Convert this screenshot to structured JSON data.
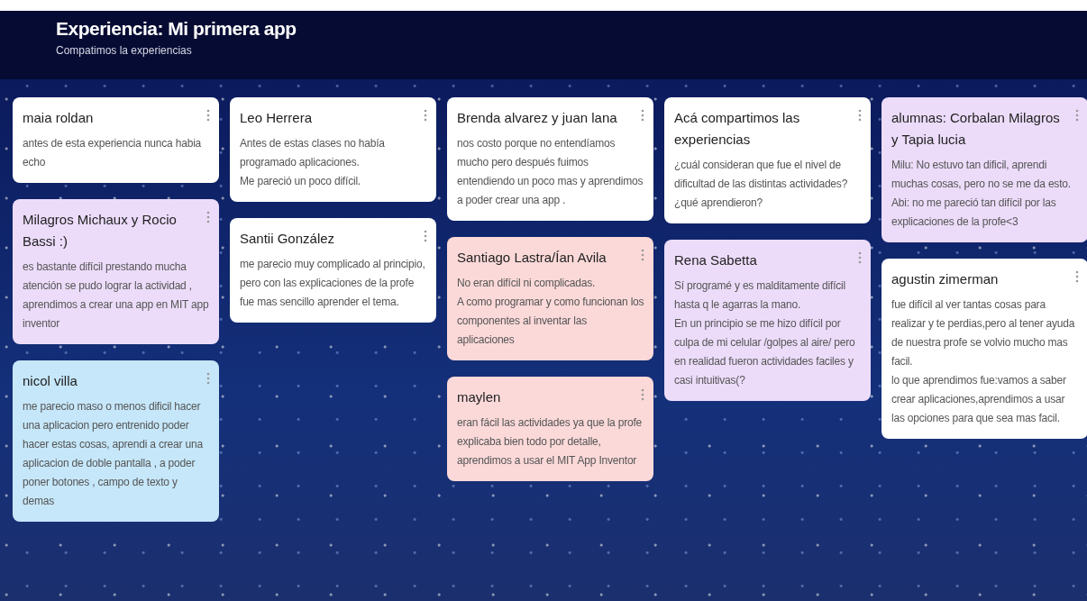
{
  "header": {
    "title": "Experiencia: Mi primera app",
    "subtitle": "Compatimos la experiencias"
  },
  "columns": [
    [
      {
        "title": "maia roldan",
        "body": "antes de esta experiencia nunca habia echo",
        "color": "#ffffff"
      },
      {
        "title": "Milagros Michaux y Rocio Bassi :)",
        "body": "es bastante difícil prestando mucha atención se pudo lograr  la actividad , aprendimos a crear una app en MIT app inventor",
        "color": "#ecdcfa"
      },
      {
        "title": "nicol villa",
        "body": "me parecio maso o menos dificil hacer una aplicacion pero entrenido poder hacer estas cosas, aprendi a crear una aplicacion de doble pantalla , a poder poner botones , campo de texto y demas",
        "color": "#c6e7fa"
      }
    ],
    [
      {
        "title": "Leo Herrera",
        "body": "Antes de estas clases no había programado aplicaciones.\nMe pareció un poco difícil.",
        "color": "#ffffff"
      },
      {
        "title": "Santii González",
        "body": "me parecio muy complicado al principio, pero con las explicaciones de la profe fue mas sencillo aprender el tema.",
        "color": "#ffffff"
      }
    ],
    [
      {
        "title": "Brenda alvarez y juan lana",
        "body": "nos costo porque no entendíamos mucho pero después fuimos entendiendo un poco mas y aprendimos a poder crear una app .",
        "color": "#ffffff"
      },
      {
        "title": "Santiago Lastra/Ían Avila",
        "body": "No eran difícil ni complicadas.\nA como programar y como funcionan los componentes al inventar las aplicaciones",
        "color": "#fcd9d9"
      },
      {
        "title": "maylen",
        "body": "eran fácil las actividades ya que la profe explicaba bien todo por detalle, aprendimos a usar el MIT App Inventor",
        "color": "#fcd9d9"
      }
    ],
    [
      {
        "title": "Acá compartimos las experiencias",
        "body": " ¿cuál consideran que fue el nivel de dificultad de las distintas actividades?  ¿qué aprendieron?",
        "color": "#ffffff"
      },
      {
        "title": "Rena Sabetta",
        "body": "Sí programé y es malditamente difícil hasta q le agarras la mano.\nEn un principio se me hizo difícil por culpa de mi celular /golpes al aire/ pero en realidad fueron actividades faciles y casi intuitivas(?",
        "color": "#ecdcfa"
      }
    ],
    [
      {
        "title": "alumnas: Corbalan Milagros y Tapia lucia",
        "body": "Milu: No estuvo tan dificil, aprendi muchas cosas, pero no se me da esto.\nAbi: no me pareció tan difícil por las explicaciones de la profe<3",
        "color": "#ecdcfa"
      },
      {
        "title": "agustin zimerman",
        "body": "fue difícil al ver tantas cosas para realizar y te perdias,pero al tener ayuda de nuestra profe se volvio mucho mas facil.\nlo que aprendimos fue:vamos a saber crear aplicaciones,aprendimos a usar las opciones para que sea mas facil.",
        "color": "#ffffff"
      }
    ]
  ]
}
